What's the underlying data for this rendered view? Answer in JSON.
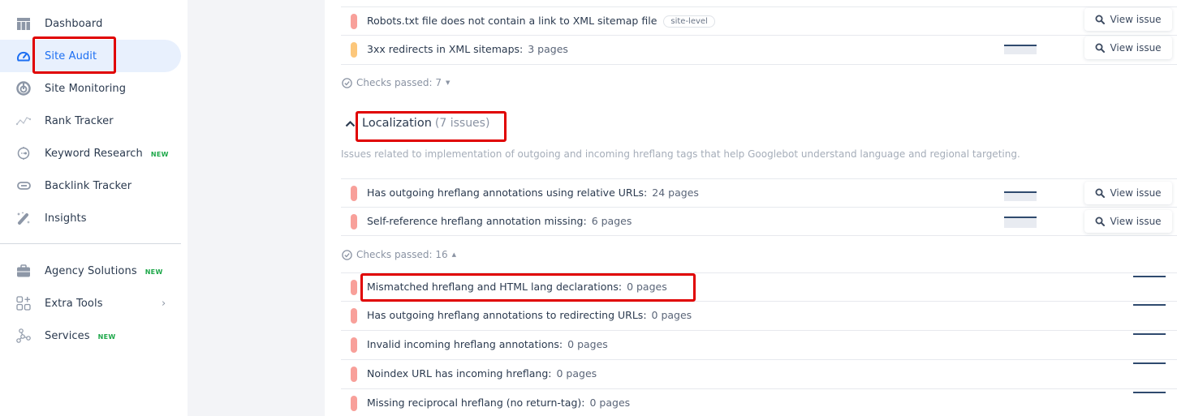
{
  "sidebar": {
    "items": [
      {
        "label": "Dashboard",
        "icon": "dashboard-icon",
        "active": false,
        "badge": ""
      },
      {
        "label": "Site Audit",
        "icon": "gauge-icon",
        "active": true,
        "badge": ""
      },
      {
        "label": "Site Monitoring",
        "icon": "radar-icon",
        "active": false,
        "badge": ""
      },
      {
        "label": "Rank Tracker",
        "icon": "trend-line-icon",
        "active": false,
        "badge": ""
      },
      {
        "label": "Keyword Research",
        "icon": "keyword-icon",
        "active": false,
        "badge": "NEW"
      },
      {
        "label": "Backlink Tracker",
        "icon": "link-icon",
        "active": false,
        "badge": ""
      },
      {
        "label": "Insights",
        "icon": "magic-wand-icon",
        "active": false,
        "badge": ""
      }
    ],
    "secondary_items": [
      {
        "label": "Agency Solutions",
        "icon": "briefcase-icon",
        "badge": "NEW"
      },
      {
        "label": "Extra Tools",
        "icon": "apps-plus-icon",
        "badge": "",
        "chevron": "›"
      },
      {
        "label": "Services",
        "icon": "nodes-icon",
        "badge": "NEW"
      }
    ]
  },
  "main": {
    "top_issues": [
      {
        "title": "Robots.txt file does not contain a link to XML sitemap file",
        "count": "",
        "tag": "site-level",
        "severity": "error",
        "view_label": "View issue",
        "trend": []
      },
      {
        "title": "3xx redirects in XML sitemaps:",
        "count": "3 pages",
        "tag": "",
        "severity": "warning",
        "view_label": "View issue",
        "trend": [
          3,
          3,
          3,
          3,
          3,
          3
        ]
      }
    ],
    "top_checks_passed": {
      "label": "Checks passed: 7",
      "caret": "▼"
    },
    "section": {
      "title": "Localization",
      "count": "(7 issues)",
      "chevron": "^",
      "description": "Issues related to implementation of outgoing and incoming hreflang tags that help Googlebot understand language and regional targeting."
    },
    "section_issues": [
      {
        "title": "Has outgoing hreflang annotations using relative URLs:",
        "count": "24 pages",
        "severity": "error",
        "view_label": "View issue",
        "trend": [
          24,
          24,
          24,
          24,
          24,
          24
        ]
      },
      {
        "title": "Self-reference hreflang annotation missing:",
        "count": "6 pages",
        "severity": "error",
        "view_label": "View issue",
        "trend": [
          6,
          6,
          6,
          6,
          6,
          6
        ]
      }
    ],
    "section_checks_passed": {
      "label": "Checks passed: 16",
      "caret": "▲"
    },
    "passed_checks": [
      {
        "title": "Mismatched hreflang and HTML lang declarations:",
        "count": "0 pages",
        "trend": [
          0,
          0,
          0,
          0,
          0,
          0
        ]
      },
      {
        "title": "Has outgoing hreflang annotations to redirecting URLs:",
        "count": "0 pages",
        "trend": [
          0,
          0,
          0,
          0,
          0,
          0
        ]
      },
      {
        "title": "Invalid incoming hreflang annotations:",
        "count": "0 pages",
        "trend": [
          0,
          0,
          0,
          0,
          0,
          0
        ]
      },
      {
        "title": "Noindex URL has incoming hreflang:",
        "count": "0 pages",
        "trend": [
          0,
          0,
          0,
          0,
          0,
          0
        ]
      },
      {
        "title": "Missing reciprocal hreflang (no return-tag):",
        "count": "0 pages",
        "trend": [
          0,
          0,
          0,
          0,
          0,
          0
        ]
      }
    ]
  },
  "colors": {
    "accent": "#1d6ff2",
    "error": "#f8a09a",
    "warning": "#fcc77b",
    "highlight": "#e00000",
    "new_badge": "#1ea84a",
    "sparkline": "#2f4a6e"
  }
}
